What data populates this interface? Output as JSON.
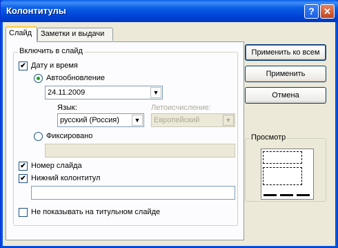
{
  "window": {
    "title": "Колонтитулы"
  },
  "titlebar": {
    "help_glyph": "?",
    "close_glyph": "✕"
  },
  "tabs": [
    {
      "label": "Слайд"
    },
    {
      "label": "Заметки и выдачи"
    }
  ],
  "slide_tab": {
    "group_label": "Включить в слайд",
    "date_time": {
      "label": "Дату и время",
      "checked": true
    },
    "auto_update": {
      "label": "Автообновление",
      "selected": true,
      "date_value": "24.11.2009"
    },
    "language": {
      "label": "Язык:",
      "value": "русский (Россия)"
    },
    "calendar": {
      "label": "Летоисчисление:",
      "value": "Европейский",
      "disabled": true
    },
    "fixed": {
      "label": "Фиксировано",
      "selected": false,
      "value": ""
    },
    "slide_number": {
      "label": "Номер слайда",
      "checked": true
    },
    "footer": {
      "label": "Нижний колонтитул",
      "checked": true,
      "value": ""
    },
    "hide_on_title": {
      "label": "Не показывать на титульном слайде",
      "checked": false
    }
  },
  "buttons": {
    "apply_all": "Применить ко всем",
    "apply": "Применить",
    "cancel": "Отмена"
  },
  "preview": {
    "label": "Просмотр"
  },
  "icons": {
    "dropdown": "chevron-down-icon"
  },
  "colors": {
    "titlebar": "#0054e3",
    "dialog_bg": "#ece9d8",
    "tab_highlight": "#ffc83c"
  }
}
